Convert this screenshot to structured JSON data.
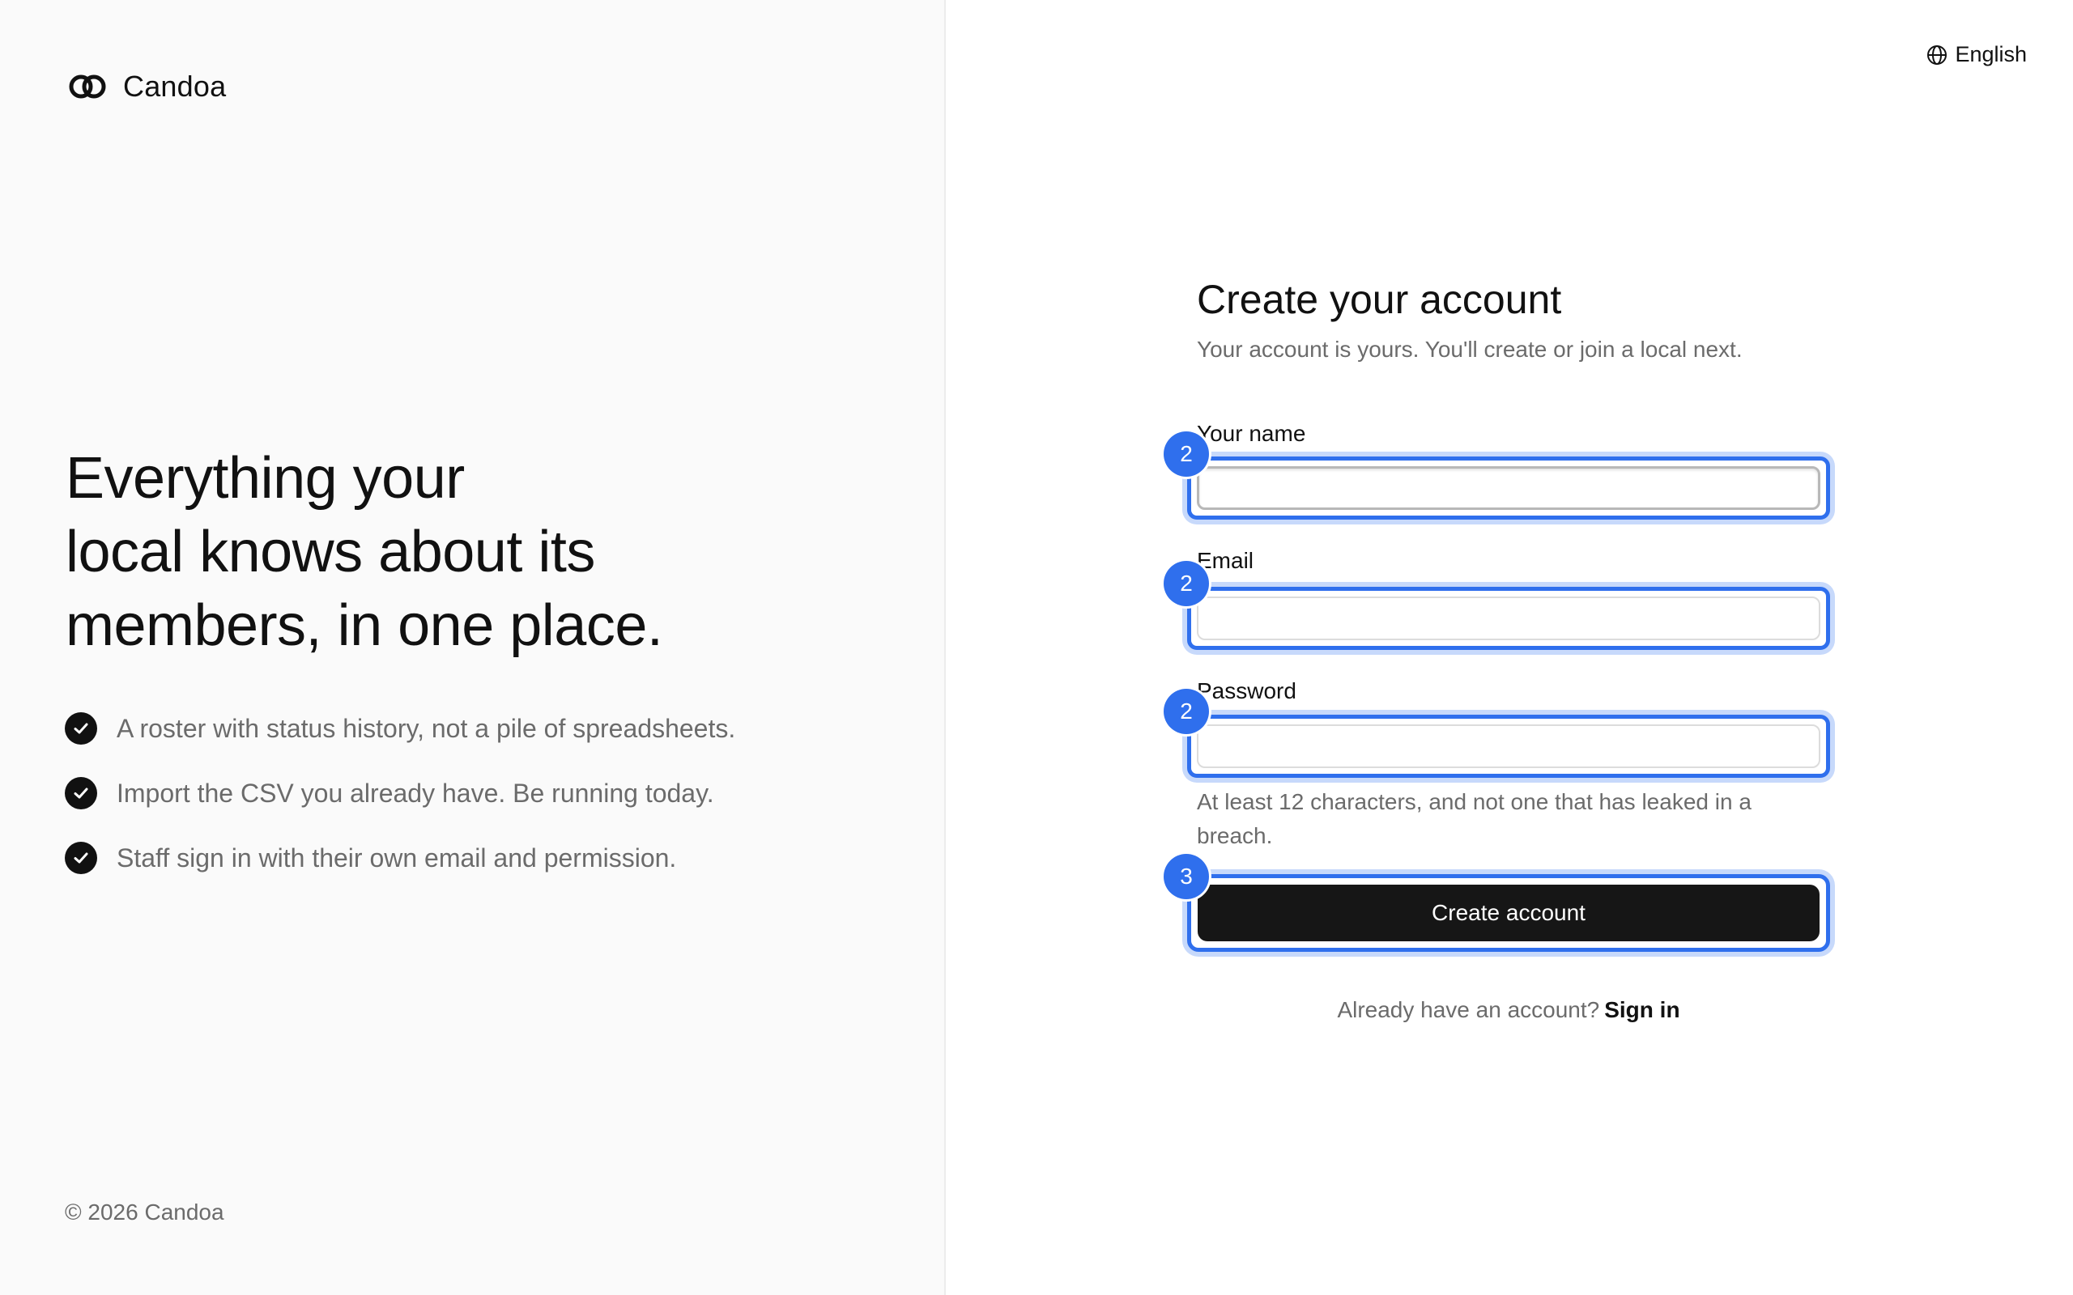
{
  "brand": {
    "name": "Candoa"
  },
  "language": {
    "label": "English"
  },
  "hero": {
    "lines": [
      "Everything your",
      "local knows about its",
      "members, in one place."
    ]
  },
  "features": [
    "A roster with status history, not a pile of spreadsheets.",
    "Import the CSV you already have. Be running today.",
    "Staff sign in with their own email and permission."
  ],
  "footer": {
    "copyright": "© 2026 Candoa"
  },
  "form": {
    "title": "Create your account",
    "subtitle": "Your account is yours. You'll create or join a local next.",
    "fields": {
      "name": {
        "label": "Your name",
        "value": "",
        "badge": "2"
      },
      "email": {
        "label": "Email",
        "value": "",
        "badge": "2"
      },
      "password": {
        "label": "Password",
        "value": "",
        "badge": "2",
        "hint": "At least 12 characters, and not one that has leaked in a breach."
      }
    },
    "submit": {
      "label": "Create account",
      "badge": "3"
    },
    "signin": {
      "prompt": "Already have an account?",
      "link": "Sign in"
    }
  },
  "colors": {
    "accent": "#2f6fed",
    "primary_button": "#161616",
    "muted_text": "#6b6b6b",
    "left_bg": "#fafafa"
  },
  "icons": {
    "logo": "interlocking-rings-logo",
    "language": "globe-icon",
    "feature": "check-circle-icon"
  }
}
